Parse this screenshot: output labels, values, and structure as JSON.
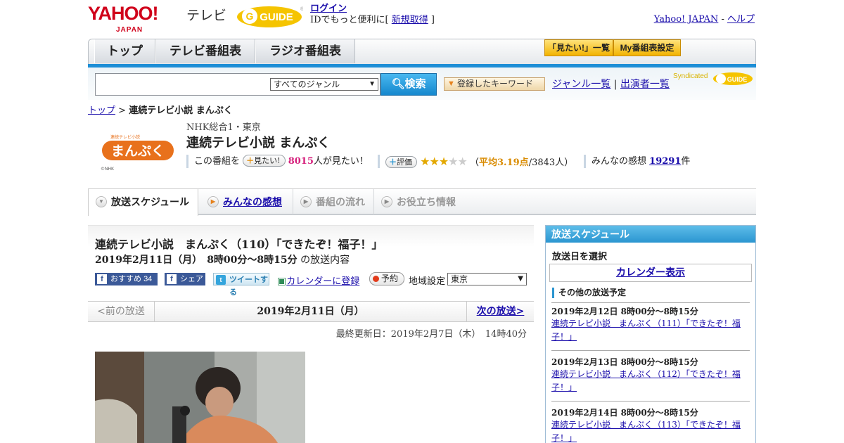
{
  "header": {
    "yahoo_logo": "YAHOO!",
    "yahoo_logo_sub": "JAPAN",
    "tv_label": "テレビ",
    "gguide_logo": "G-GUIDE",
    "login": "ログイン",
    "login_note_prefix": "IDでもっと便利に[ ",
    "signup": "新規取得",
    "login_note_suffix": " ]",
    "yahoo_japan": "Yahoo! JAPAN",
    "sep": " - ",
    "help": "ヘルプ"
  },
  "nav": {
    "tabs": [
      "トップ",
      "テレビ番組表",
      "ラジオ番組表"
    ],
    "mitai_list": "「見たい!」一覧",
    "my_schedule": "My番組表設定"
  },
  "search": {
    "input_value": "",
    "genre": "すべてのジャンル",
    "button": "検索",
    "keyword_button": "登録したキーワード",
    "genre_list": "ジャンル一覧",
    "divider": " | ",
    "performer_list": "出演者一覧",
    "syndicated": "Syndicated"
  },
  "breadcrumb": {
    "top": "トップ",
    "sep": " > ",
    "current": "連続テレビ小説 まんぷく"
  },
  "program": {
    "logo_text": "まんぷく",
    "logo_credit": "©NHK",
    "channel": "NHK総合1・東京",
    "title": "連続テレビ小説 まんぷく",
    "mitai_prefix": "この番組を",
    "mitai_button": "見たい!",
    "mitai_count": "8015",
    "mitai_suffix": "人が見たい！",
    "rate_button": "評価",
    "rating_stars": 3,
    "rating_max": 5,
    "avg_open": "（",
    "avg_label": "平均3.19点",
    "avg_count": "/3843人）",
    "review_prefix": "みんなの感想",
    "review_count": "19291",
    "review_suffix": "件"
  },
  "tabs": {
    "schedule": "放送スケジュール",
    "reviews": "みんなの感想",
    "flow": "番組の流れ",
    "info": "お役立ち情報"
  },
  "episode": {
    "title": "連続テレビ小説　まんぷく（110）「できたぞ！福子！」",
    "date_time": "2019年2月11日（月）　8時00分～8時15分",
    "date_time_suffix": "の放送内容",
    "recommend": "おすすめ",
    "recommend_count": "34",
    "share": "シェア",
    "tweet": "ツイートする",
    "calendar_register": "カレンダーに登録",
    "reserve": "予約",
    "region_label": "地域設定",
    "region_value": "東京",
    "prev": "<前の放送",
    "current_date": "2019年2月11日（月）",
    "next": "次の放送>",
    "updated": "最終更新日：2019年2月7日（木）　14時40分"
  },
  "sidebar": {
    "title": "放送スケジュール",
    "select_date": "放送日を選択",
    "calendar": "カレンダー表示",
    "other_title": "その他の放送予定",
    "items": [
      {
        "date": "2019年2月12日  8時00分～8時15分",
        "title": "連続テレビ小説　まんぷく（111）「できたぞ！福子！」"
      },
      {
        "date": "2019年2月13日  8時00分～8時15分",
        "title": "連続テレビ小説　まんぷく（112）「できたぞ！福子！」"
      },
      {
        "date": "2019年2月14日  8時00分～8時15分",
        "title": "連続テレビ小説　まんぷく（113）「できたぞ！福子！」"
      }
    ]
  },
  "colors": {
    "accent_blue": "#1d8ed6",
    "yahoo_red": "#d0021b",
    "gguide_yellow": "#f5c400",
    "program_orange": "#e8711c"
  }
}
